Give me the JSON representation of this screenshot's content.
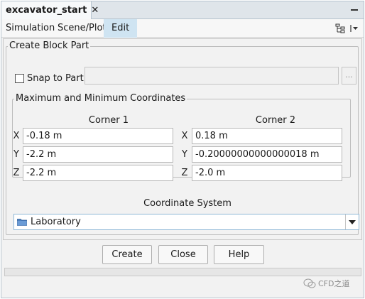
{
  "tab": {
    "title": "excavator_start",
    "close_glyph": "✕"
  },
  "menu": {
    "items": [
      "Simulation",
      "Scene/Plot",
      "Edit"
    ],
    "active": "Edit"
  },
  "create_block_part": {
    "title": "Create Block Part",
    "snap_to_part": {
      "label": "Snap to Part",
      "checked": false,
      "value": "",
      "browse_label": "..."
    },
    "coordinates": {
      "title": "Maximum and Minimum Coordinates",
      "corner1": {
        "label": "Corner 1",
        "x": "-0.18 m",
        "y": "-2.2 m",
        "z": "-2.2 m"
      },
      "corner2": {
        "label": "Corner 2",
        "x": "0.18 m",
        "y": "-0.20000000000000018 m",
        "z": "-2.0 m"
      },
      "axes": [
        "X",
        "Y",
        "Z"
      ]
    },
    "coordinate_system": {
      "label": "Coordinate System",
      "value": "Laboratory"
    }
  },
  "buttons": {
    "create": "Create",
    "close": "Close",
    "help": "Help"
  },
  "watermark": "CFD之道",
  "colors": {
    "tab_bar": "#dfe5ea",
    "menu_active": "#cfe4f2",
    "folder_icon": "#4a7fc0"
  }
}
